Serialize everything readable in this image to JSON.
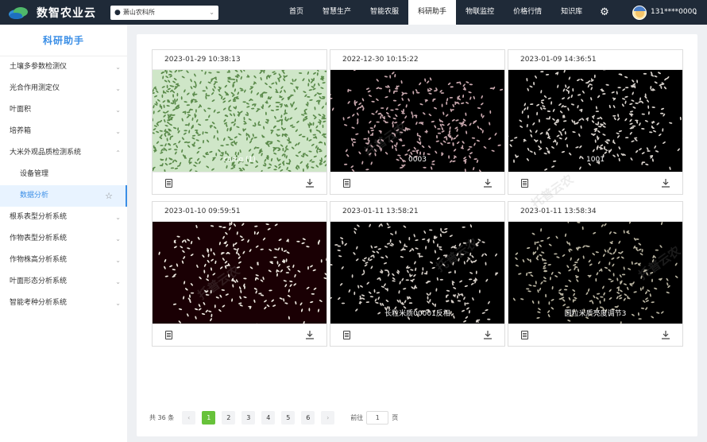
{
  "app": {
    "name": "数智农业云"
  },
  "location": {
    "value": "萧山农科所"
  },
  "nav": [
    {
      "label": "首页"
    },
    {
      "label": "智慧生产"
    },
    {
      "label": "智能农服"
    },
    {
      "label": "科研助手"
    },
    {
      "label": "物联监控"
    },
    {
      "label": "价格行情"
    },
    {
      "label": "知识库"
    }
  ],
  "nav_active_index": 3,
  "user": {
    "phone": "131****0000"
  },
  "sidebar": {
    "title": "科研助手",
    "items": [
      {
        "label": "土壤多参数检测仪"
      },
      {
        "label": "光合作用测定仪"
      },
      {
        "label": "叶面积"
      },
      {
        "label": "培养箱"
      },
      {
        "label": "大米外观品质检测系统"
      },
      {
        "label": "设备管理"
      },
      {
        "label": "数据分析"
      },
      {
        "label": "根系表型分析系统"
      },
      {
        "label": "作物表型分析系统"
      },
      {
        "label": "作物株高分析系统"
      },
      {
        "label": "叶面形态分析系统"
      },
      {
        "label": "智能考种分析系统"
      }
    ]
  },
  "cards": [
    {
      "time": "2023-01-29 10:38:13",
      "caption": "camg (1)",
      "bg": "#cfe6c8",
      "dot": "#5a8a4a",
      "count": 700
    },
    {
      "time": "2022-12-30 10:15:22",
      "caption": "0003",
      "bg": "#000000",
      "dot": "#c9a8ae",
      "count": 330
    },
    {
      "time": "2023-01-09 14:36:51",
      "caption": "1001",
      "bg": "#000000",
      "dot": "#d8d2cc",
      "count": 320
    },
    {
      "time": "2023-01-10 09:59:51",
      "caption": "",
      "bg": "#1a0004",
      "dot": "#ece8e0",
      "count": 230
    },
    {
      "time": "2023-01-11 13:58:21",
      "caption": "长粒米质00001反相",
      "bg": "#000000",
      "dot": "#d6cfc8",
      "count": 280
    },
    {
      "time": "2023-01-11 13:58:34",
      "caption": "圆粒米质亮度调节3",
      "bg": "#000000",
      "dot": "#b8b3a0",
      "count": 260
    }
  ],
  "pagination": {
    "total": "共 36 条",
    "pages": [
      "1",
      "2",
      "3",
      "4",
      "5",
      "6"
    ],
    "current": "1",
    "goto_label": "前往",
    "goto_value": "1",
    "page_unit": "页"
  },
  "watermark": "托普云农",
  "colors": {
    "topbar": "#1f2a38",
    "accent": "#3a8ee6",
    "pager_active": "#67c23a"
  }
}
